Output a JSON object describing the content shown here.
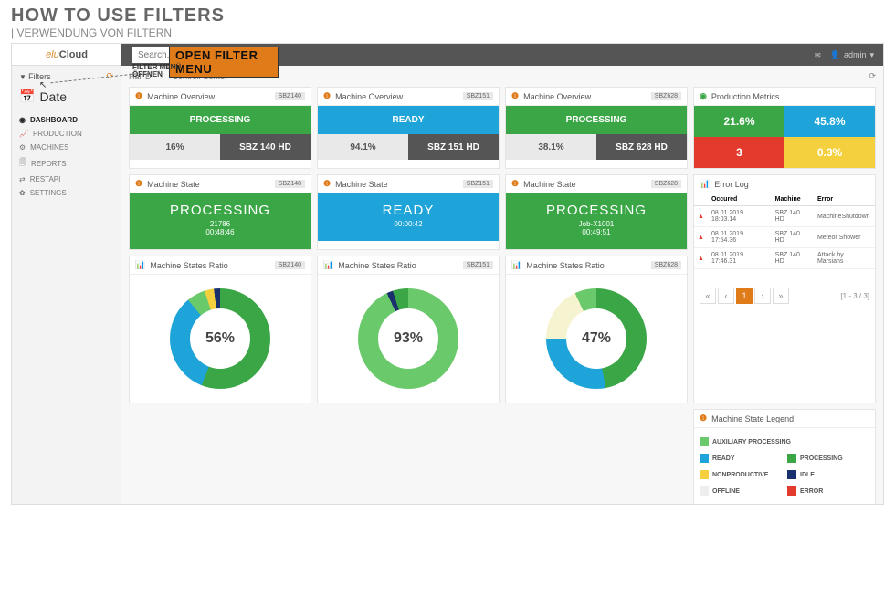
{
  "slide": {
    "title": "HOW TO USE FILTERS",
    "subtitle": "| VERWENDUNG VON FILTERN"
  },
  "annot": {
    "label": "OPEN FILTER MENU",
    "sub1": "FILTER MENÜ",
    "sub2": "ÖFFNEN"
  },
  "logo": {
    "a": "elu",
    "b": "Cloud"
  },
  "search": {
    "placeholder": "Search..."
  },
  "user": {
    "name": "admin"
  },
  "sidebar": {
    "filters_label": "Filters",
    "date_label": "Date",
    "nav": [
      {
        "label": "DASHBOARD",
        "icon": "◉"
      },
      {
        "label": "PRODUCTION",
        "icon": "📈"
      },
      {
        "label": "MACHINES",
        "icon": "⚙"
      },
      {
        "label": "REPORTS",
        "icon": "🗐"
      },
      {
        "label": "RESTAPI",
        "icon": "⇄"
      },
      {
        "label": "SETTINGS",
        "icon": "✿"
      }
    ]
  },
  "breadcrumb": {
    "a": "Hall D",
    "b": "Controll Center"
  },
  "overview": [
    {
      "title": "Machine Overview",
      "tag": "SBZ140",
      "status": "PROCESSING",
      "statusClass": "green",
      "pct": "16%",
      "model": "SBZ 140 HD"
    },
    {
      "title": "Machine Overview",
      "tag": "SBZ151",
      "status": "READY",
      "statusClass": "blue",
      "pct": "94.1%",
      "model": "SBZ 151 HD"
    },
    {
      "title": "Machine Overview",
      "tag": "SBZ628",
      "status": "PROCESSING",
      "statusClass": "green",
      "pct": "38.1%",
      "model": "SBZ 628 HD"
    }
  ],
  "metrics": {
    "title": "Production Metrics",
    "cells": [
      {
        "v": "21.6%",
        "c": "green"
      },
      {
        "v": "45.8%",
        "c": "blue"
      },
      {
        "v": "3",
        "c": "red"
      },
      {
        "v": "0.3%",
        "c": "yellow"
      }
    ]
  },
  "state": [
    {
      "title": "Machine State",
      "tag": "SBZ140",
      "c": "green",
      "big": "PROCESSING",
      "sub": "21786",
      "sub2": "00:48:46"
    },
    {
      "title": "Machine State",
      "tag": "SBZ151",
      "c": "blue",
      "big": "READY",
      "sub": "",
      "sub2": "00:00:42"
    },
    {
      "title": "Machine State",
      "tag": "SBZ628",
      "c": "green",
      "big": "PROCESSING",
      "sub": "Job-X1001",
      "sub2": "00:49:51"
    }
  ],
  "errorlog": {
    "title": "Error Log",
    "headers": [
      "Occured",
      "Machine",
      "Error"
    ],
    "rows": [
      [
        "08.01.2019 18:03.14",
        "SBZ 140 HD",
        "MachineShutdown"
      ],
      [
        "08.01.2019 17:54.36",
        "SBZ 140 HD",
        "Meteor Shower"
      ],
      [
        "08.01.2019 17:46.31",
        "SBZ 140 HD",
        "Attack by Marsians"
      ]
    ],
    "pager": {
      "page": "1",
      "info": "[1 - 3 / 3]"
    }
  },
  "ratio": [
    {
      "title": "Machine States Ratio",
      "tag": "SBZ140",
      "pct": "56%"
    },
    {
      "title": "Machine States Ratio",
      "tag": "SBZ151",
      "pct": "93%"
    },
    {
      "title": "Machine States Ratio",
      "tag": "SBZ628",
      "pct": "47%"
    }
  ],
  "legend": {
    "title": "Machine State Legend",
    "items": [
      {
        "label": "AUXILIARY PROCESSING",
        "sw": "sw-aux"
      },
      {
        "label": "READY",
        "sw": "sw-ready"
      },
      {
        "label": "PROCESSING",
        "sw": "sw-proc"
      },
      {
        "label": "NONPRODUCTIVE",
        "sw": "sw-nonp"
      },
      {
        "label": "IDLE",
        "sw": "sw-idle"
      },
      {
        "label": "OFFLINE",
        "sw": "sw-off"
      },
      {
        "label": "ERROR",
        "sw": "sw-err"
      }
    ]
  },
  "chart_data": [
    {
      "type": "pie",
      "title": "Machine States Ratio SBZ140",
      "center": 56,
      "series": [
        {
          "name": "PROCESSING",
          "value": 56,
          "color": "#3aa646"
        },
        {
          "name": "READY",
          "value": 33,
          "color": "#1ea4d8"
        },
        {
          "name": "AUXILIARY PROCESSING",
          "value": 6,
          "color": "#6ac96a"
        },
        {
          "name": "NONPRODUCTIVE",
          "value": 3,
          "color": "#f4d03f"
        },
        {
          "name": "IDLE",
          "value": 2,
          "color": "#1a2f6e"
        }
      ]
    },
    {
      "type": "pie",
      "title": "Machine States Ratio SBZ151",
      "center": 93,
      "series": [
        {
          "name": "AUXILIARY PROCESSING",
          "value": 93,
          "color": "#6ac96a"
        },
        {
          "name": "IDLE",
          "value": 2,
          "color": "#1a2f6e"
        },
        {
          "name": "PROCESSING",
          "value": 5,
          "color": "#3aa646"
        }
      ]
    },
    {
      "type": "pie",
      "title": "Machine States Ratio SBZ628",
      "center": 47,
      "series": [
        {
          "name": "PROCESSING",
          "value": 47,
          "color": "#3aa646"
        },
        {
          "name": "READY",
          "value": 28,
          "color": "#1ea4d8"
        },
        {
          "name": "OFFLINE",
          "value": 18,
          "color": "#f6f3d0"
        },
        {
          "name": "AUXILIARY PROCESSING",
          "value": 7,
          "color": "#6ac96a"
        }
      ]
    }
  ]
}
